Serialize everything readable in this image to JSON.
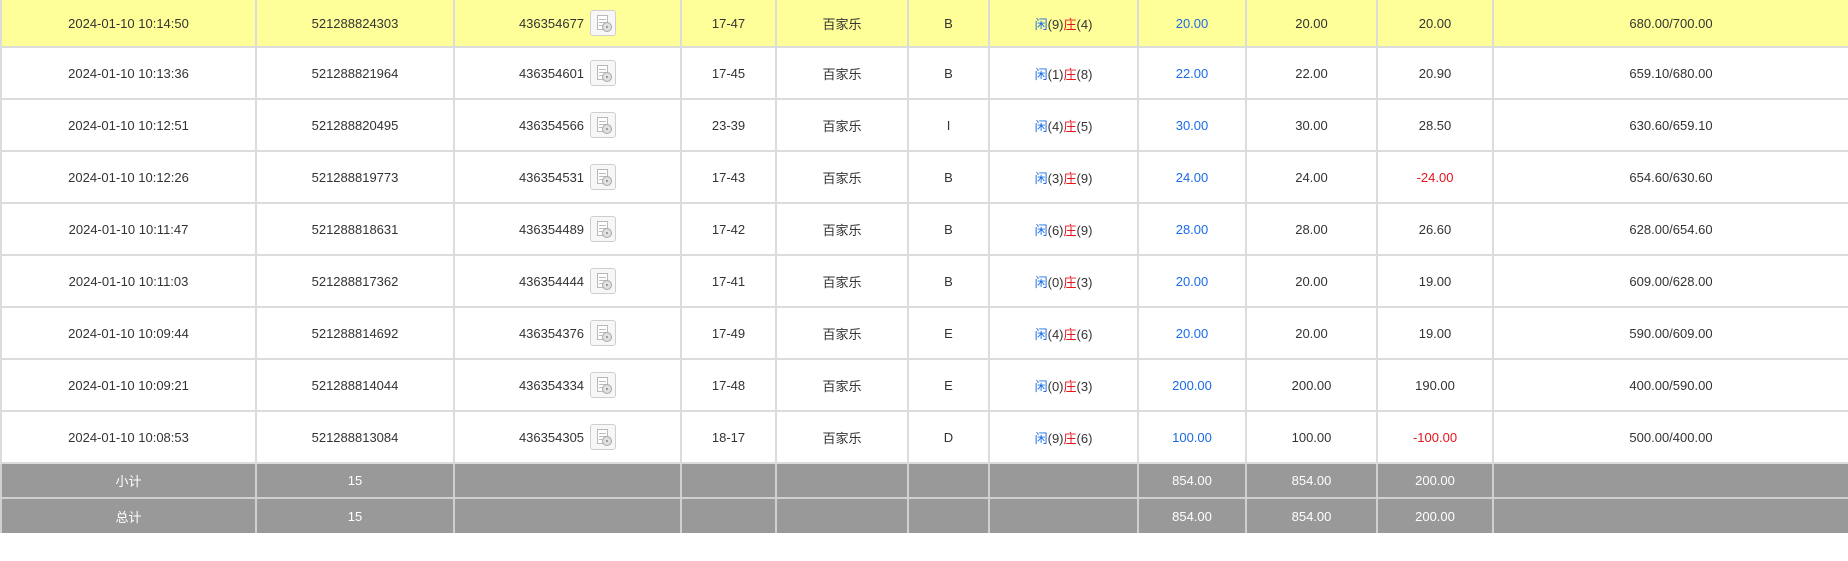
{
  "colors": {
    "highlight_row": "#ffff99",
    "summary_row": "#999999",
    "player": "#1a6be8",
    "banker": "#e6141e",
    "negative": "#e6141e"
  },
  "icons": {
    "record": "replay-record-icon"
  },
  "rows": [
    {
      "time": "2024-01-10 10:14:50",
      "order_no": "521288824303",
      "round_no": "436354677",
      "table": "17-47",
      "game": "百家乐",
      "type": "B",
      "player_label": "闲",
      "player_point": "(9)",
      "banker_label": "庄",
      "banker_point": "(4)",
      "bet": "20.00",
      "valid_bet": "20.00",
      "payout": "20.00",
      "balance": "680.00/700.00"
    },
    {
      "time": "2024-01-10 10:13:36",
      "order_no": "521288821964",
      "round_no": "436354601",
      "table": "17-45",
      "game": "百家乐",
      "type": "B",
      "player_label": "闲",
      "player_point": "(1)",
      "banker_label": "庄",
      "banker_point": "(8)",
      "bet": "22.00",
      "valid_bet": "22.00",
      "payout": "20.90",
      "balance": "659.10/680.00"
    },
    {
      "time": "2024-01-10 10:12:51",
      "order_no": "521288820495",
      "round_no": "436354566",
      "table": "23-39",
      "game": "百家乐",
      "type": "I",
      "player_label": "闲",
      "player_point": "(4)",
      "banker_label": "庄",
      "banker_point": "(5)",
      "bet": "30.00",
      "valid_bet": "30.00",
      "payout": "28.50",
      "balance": "630.60/659.10"
    },
    {
      "time": "2024-01-10 10:12:26",
      "order_no": "521288819773",
      "round_no": "436354531",
      "table": "17-43",
      "game": "百家乐",
      "type": "B",
      "player_label": "闲",
      "player_point": "(3)",
      "banker_label": "庄",
      "banker_point": "(9)",
      "bet": "24.00",
      "valid_bet": "24.00",
      "payout": "-24.00",
      "balance": "654.60/630.60"
    },
    {
      "time": "2024-01-10 10:11:47",
      "order_no": "521288818631",
      "round_no": "436354489",
      "table": "17-42",
      "game": "百家乐",
      "type": "B",
      "player_label": "闲",
      "player_point": "(6)",
      "banker_label": "庄",
      "banker_point": "(9)",
      "bet": "28.00",
      "valid_bet": "28.00",
      "payout": "26.60",
      "balance": "628.00/654.60"
    },
    {
      "time": "2024-01-10 10:11:03",
      "order_no": "521288817362",
      "round_no": "436354444",
      "table": "17-41",
      "game": "百家乐",
      "type": "B",
      "player_label": "闲",
      "player_point": "(0)",
      "banker_label": "庄",
      "banker_point": "(3)",
      "bet": "20.00",
      "valid_bet": "20.00",
      "payout": "19.00",
      "balance": "609.00/628.00"
    },
    {
      "time": "2024-01-10 10:09:44",
      "order_no": "521288814692",
      "round_no": "436354376",
      "table": "17-49",
      "game": "百家乐",
      "type": "E",
      "player_label": "闲",
      "player_point": "(4)",
      "banker_label": "庄",
      "banker_point": "(6)",
      "bet": "20.00",
      "valid_bet": "20.00",
      "payout": "19.00",
      "balance": "590.00/609.00"
    },
    {
      "time": "2024-01-10 10:09:21",
      "order_no": "521288814044",
      "round_no": "436354334",
      "table": "17-48",
      "game": "百家乐",
      "type": "E",
      "player_label": "闲",
      "player_point": "(0)",
      "banker_label": "庄",
      "banker_point": "(3)",
      "bet": "200.00",
      "valid_bet": "200.00",
      "payout": "190.00",
      "balance": "400.00/590.00"
    },
    {
      "time": "2024-01-10 10:08:53",
      "order_no": "521288813084",
      "round_no": "436354305",
      "table": "18-17",
      "game": "百家乐",
      "type": "D",
      "player_label": "闲",
      "player_point": "(9)",
      "banker_label": "庄",
      "banker_point": "(6)",
      "bet": "100.00",
      "valid_bet": "100.00",
      "payout": "-100.00",
      "balance": "500.00/400.00"
    }
  ],
  "summary": {
    "subtotal": {
      "label": "小计",
      "count": "15",
      "bet": "854.00",
      "valid_bet": "854.00",
      "payout": "200.00"
    },
    "total": {
      "label": "总计",
      "count": "15",
      "bet": "854.00",
      "valid_bet": "854.00",
      "payout": "200.00"
    }
  }
}
